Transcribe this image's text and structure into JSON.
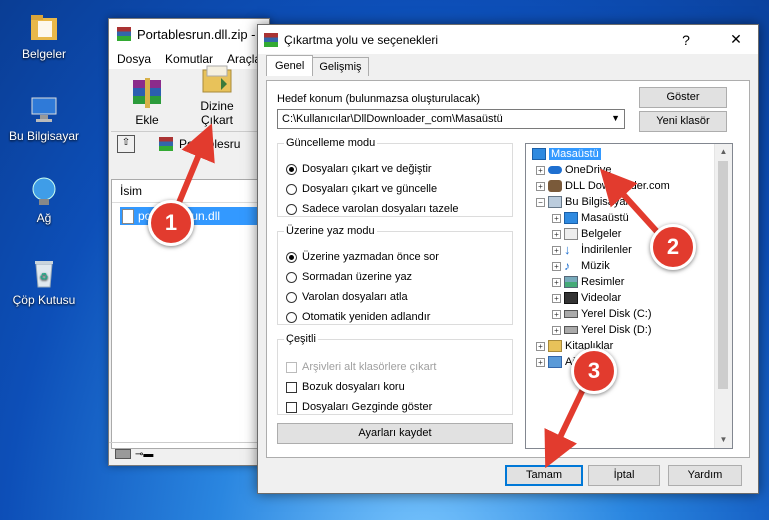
{
  "desktop": {
    "icons": [
      {
        "label": "Belgeler"
      },
      {
        "label": "Bu Bilgisayar"
      },
      {
        "label": "Ağ"
      },
      {
        "label": "Çöp Kutusu"
      }
    ]
  },
  "winrar": {
    "title": "Portablesrun.dll.zip -",
    "menu": [
      "Dosya",
      "Komutlar",
      "Araçla"
    ],
    "toolbar": {
      "add": "Ekle",
      "extract_to": "Dizine Çıkart"
    },
    "address": "Portablesru",
    "list_header": "İsim",
    "file": "portablesrun.dll"
  },
  "dialog": {
    "title": "Çıkartma yolu ve seçenekleri",
    "tabs": [
      "Genel",
      "Gelişmiş"
    ],
    "dest_label": "Hedef konum (bulunmazsa oluşturulacak)",
    "dest_value": "C:\\Kullanıcılar\\DllDownloader_com\\Masaüstü",
    "show_btn": "Göster",
    "new_folder_btn": "Yeni klasör",
    "update_group": {
      "title": "Güncelleme modu",
      "options": [
        "Dosyaları çıkart ve değiştir",
        "Dosyaları çıkart ve güncelle",
        "Sadece varolan dosyaları tazele"
      ],
      "selected": 0
    },
    "overwrite_group": {
      "title": "Üzerine yaz modu",
      "options": [
        "Üzerine yazmadan önce sor",
        "Sormadan üzerine yaz",
        "Varolan dosyaları atla",
        "Otomatik yeniden adlandır"
      ],
      "selected": 0
    },
    "misc_group": {
      "title": "Çeşitli",
      "options": [
        "Arşivleri alt klasörlere çıkart",
        "Bozuk dosyaları koru",
        "Dosyaları Gezginde göster"
      ]
    },
    "save_settings_btn": "Ayarları kaydet",
    "tree": [
      {
        "label": "Masaüstü",
        "icon": "desktop-icon"
      },
      {
        "label": "OneDrive",
        "icon": "cloud-icon"
      },
      {
        "label": "DLL Downloader.com",
        "icon": "user-icon"
      },
      {
        "label": "Bu Bilgisayar",
        "icon": "computer-icon"
      },
      {
        "label": "Masaüstü",
        "icon": "desktop-icon"
      },
      {
        "label": "Belgeler",
        "icon": "documents-icon"
      },
      {
        "label": "İndirilenler",
        "icon": "download-icon"
      },
      {
        "label": "Müzik",
        "icon": "music-icon"
      },
      {
        "label": "Resimler",
        "icon": "pictures-icon"
      },
      {
        "label": "Videolar",
        "icon": "videos-icon"
      },
      {
        "label": "Yerel Disk (C:)",
        "icon": "drive-icon"
      },
      {
        "label": "Yerel Disk (D:)",
        "icon": "drive-icon"
      },
      {
        "label": "Kitaplıklar",
        "icon": "libraries-icon"
      },
      {
        "label": "Ağ",
        "icon": "network-icon"
      }
    ],
    "ok_btn": "Tamam",
    "cancel_btn": "İptal",
    "help_btn": "Yardım"
  },
  "annotations": [
    "1",
    "2",
    "3"
  ],
  "colors": {
    "accent": "#3399ff",
    "badge": "#e23b2e",
    "arrow": "#e23b2e"
  }
}
